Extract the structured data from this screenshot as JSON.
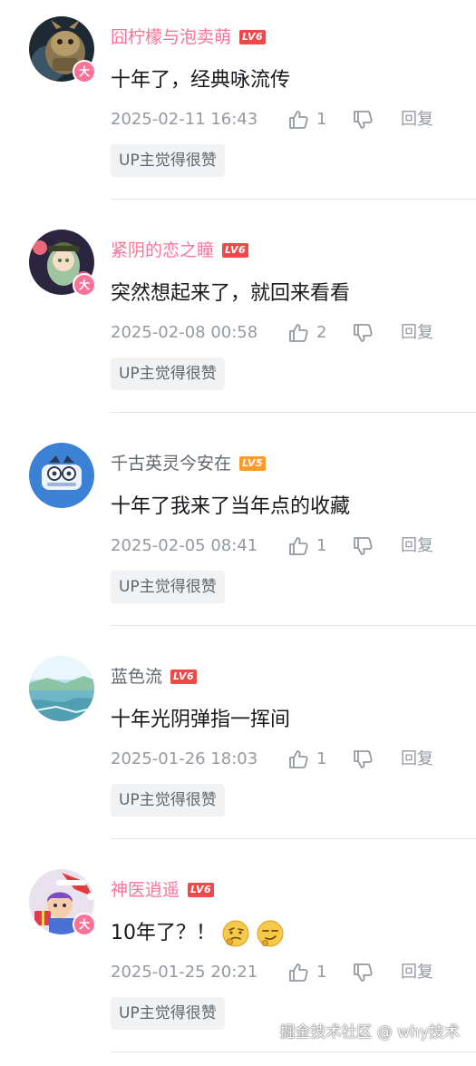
{
  "colors": {
    "vip_name": "#fb7299",
    "plain_name": "#61666d",
    "meta_text": "#9499a0",
    "level_5": "#ff9a26",
    "level_6": "#ee4848"
  },
  "icons": {
    "like": "thumbs-up-icon",
    "dislike": "thumbs-down-icon",
    "vip": "vip-badge-icon"
  },
  "comments": [
    {
      "username": "囧柠檬与泡卖萌",
      "level": "LV6",
      "vip": true,
      "vip_label": "大",
      "content": "十年了，经典咏流传",
      "time": "2025-02-11 16:43",
      "likes": "1",
      "reply_label": "回复",
      "up_tag": "UP主觉得很赞"
    },
    {
      "username": "紧阴的恋之瞳",
      "level": "LV6",
      "vip": true,
      "vip_label": "大",
      "content": "突然想起来了，就回来看看",
      "time": "2025-02-08 00:58",
      "likes": "2",
      "reply_label": "回复",
      "up_tag": "UP主觉得很赞"
    },
    {
      "username": "千古英灵今安在",
      "level": "LV5",
      "vip": false,
      "content": "十年了我来了当年点的收藏",
      "time": "2025-02-05 08:41",
      "likes": "1",
      "reply_label": "回复",
      "up_tag": "UP主觉得很赞"
    },
    {
      "username": "蓝色流",
      "level": "LV6",
      "vip": false,
      "content": "十年光阴弹指一挥间",
      "time": "2025-01-26 18:03",
      "likes": "1",
      "reply_label": "回复",
      "up_tag": "UP主觉得很赞"
    },
    {
      "username": "神医逍遥",
      "level": "LV6",
      "vip": true,
      "vip_label": "大",
      "content": "10年了？！",
      "emojis": [
        "thinking-face-emoji",
        "smirk-face-emoji"
      ],
      "time": "2025-01-25 20:21",
      "likes": "1",
      "reply_label": "回复",
      "up_tag": "UP主觉得很赞"
    }
  ],
  "watermark": "掘金技术社区 @ why技术"
}
